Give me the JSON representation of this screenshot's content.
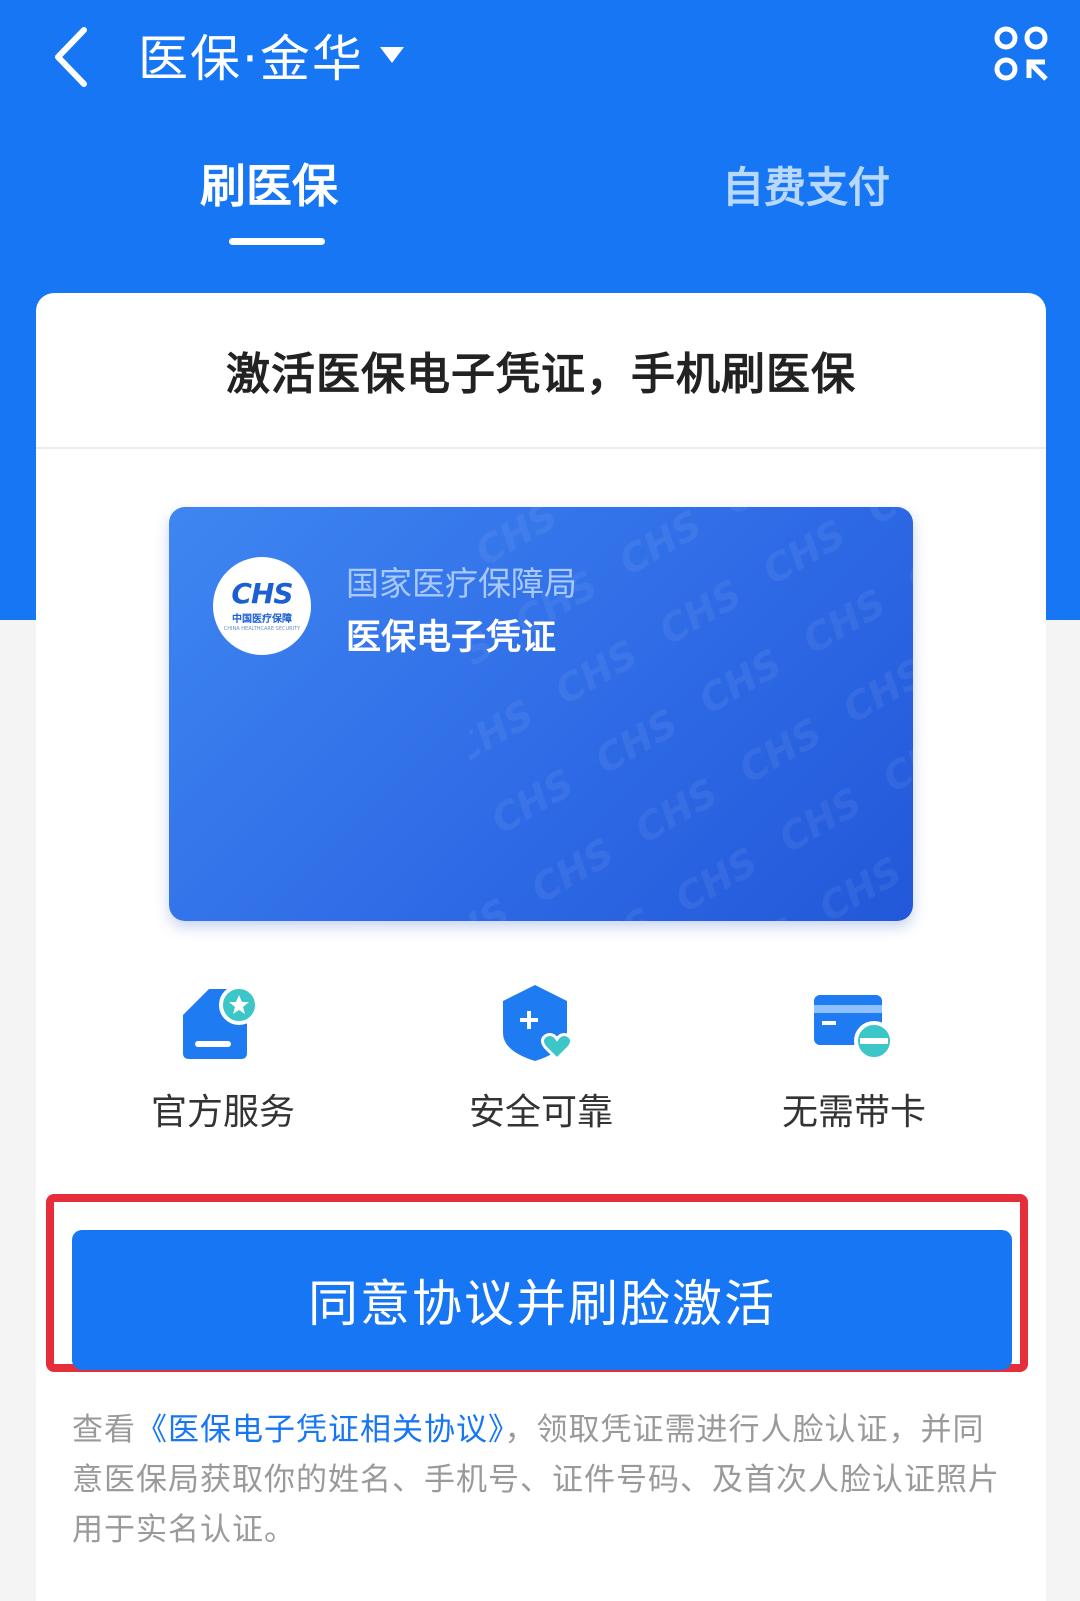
{
  "header": {
    "title": "医保·金华",
    "back_icon": "chevron-left-icon",
    "scan_icon": "scan-icon"
  },
  "tabs": [
    {
      "label": "刷医保",
      "active": true
    },
    {
      "label": "自费支付",
      "active": false
    }
  ],
  "card": {
    "title": "激活医保电子凭证，手机刷医保",
    "ehs": {
      "logo_text": "CHS",
      "logo_subtitle": "中国医疗保障",
      "logo_tiny": "CHINA HEALTHCARE SECURITY",
      "issuer": "国家医疗保障局",
      "name": "医保电子凭证"
    }
  },
  "features": [
    {
      "label": "官方服务",
      "icon": "official-service-icon"
    },
    {
      "label": "安全可靠",
      "icon": "security-shield-icon"
    },
    {
      "label": "无需带卡",
      "icon": "no-card-icon"
    }
  ],
  "cta": {
    "label": "同意协议并刷脸激活"
  },
  "notice": {
    "prefix": "查看",
    "link": "《医保电子凭证相关协议》",
    "suffix": "，领取凭证需进行人脸认证，并同意医保局获取你的姓名、手机号、证件号码、及首次人脸认证照片用于实名认证。"
  },
  "colors": {
    "primary": "#1676f3",
    "highlight_frame": "#e62e3a",
    "feature_blue": "#1e7bf2",
    "feature_teal": "#3cc6c8"
  }
}
